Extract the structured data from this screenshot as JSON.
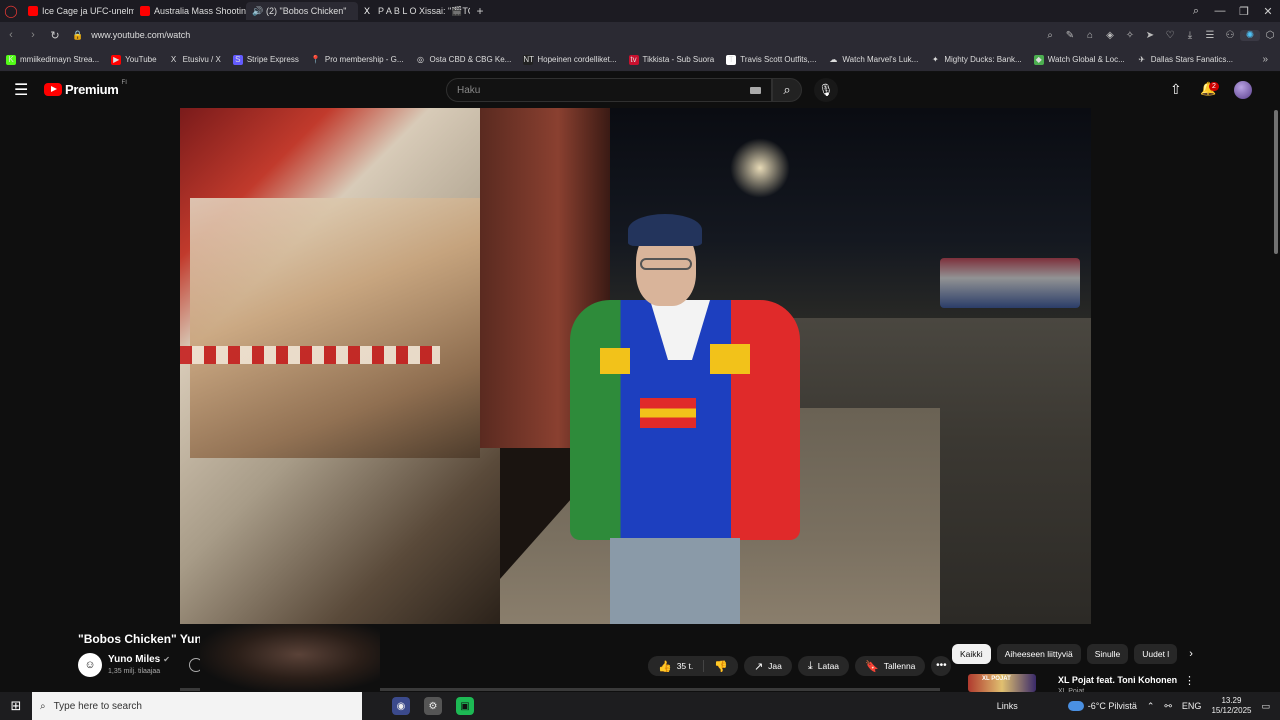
{
  "tabs": [
    {
      "label": "Ice Cage ja UFC-unelma",
      "icon": "youtube-favicon",
      "active": false
    },
    {
      "label": "Australia Mass Shooting",
      "icon": "youtube-favicon",
      "active": false
    },
    {
      "label": "(2) \"Bobos Chicken\"",
      "icon": "speaker-icon",
      "active": true
    },
    {
      "label": "P A B L O  Xissai: \"🎬TOP",
      "icon": "x-favicon",
      "active": false
    }
  ],
  "address": {
    "url": "www.youtube.com/watch"
  },
  "bookmarks": [
    {
      "label": "mmiikedimayn Strea...",
      "color": "#53fc18",
      "icon": "K"
    },
    {
      "label": "YouTube",
      "color": "#ff0000",
      "icon": "▶"
    },
    {
      "label": "Etusivu / X",
      "color": "transparent",
      "icon": "X"
    },
    {
      "label": "Stripe Express",
      "color": "#635bff",
      "icon": "S"
    },
    {
      "label": "Pro membership - G...",
      "color": "transparent",
      "icon": "📍"
    },
    {
      "label": "Osta CBD & CBG Ke...",
      "color": "transparent",
      "icon": "◎"
    },
    {
      "label": "Hopeinen cordelliket...",
      "color": "#222",
      "icon": "NT"
    },
    {
      "label": "Tikkista - Sub Suora",
      "color": "#c8102e",
      "icon": "tv"
    },
    {
      "label": "Travis Scott Outfits,...",
      "color": "#fff",
      "icon": "T"
    },
    {
      "label": "Watch Marvel's Luk...",
      "color": "transparent",
      "icon": "☁"
    },
    {
      "label": "Mighty Ducks: Bank...",
      "color": "transparent",
      "icon": "✦"
    },
    {
      "label": "Watch Global & Loc...",
      "color": "#4caf50",
      "icon": "◆"
    },
    {
      "label": "Dallas Stars Fanatics...",
      "color": "transparent",
      "icon": "✈"
    }
  ],
  "header": {
    "brand": "Premium",
    "region": "FI",
    "search_placeholder": "Haku",
    "notification_count": "2"
  },
  "video": {
    "title": "\"Bobos Chicken\" Yuno M",
    "channel_name": "Yuno Miles",
    "channel_subs": "1,35 milj. tilaajaa",
    "likes": "35 t.",
    "share_label": "Jaa",
    "download_label": "Lataa",
    "save_label": "Tallenna"
  },
  "chips": [
    {
      "label": "Kaikki",
      "active": true
    },
    {
      "label": "Aiheeseen liittyviä",
      "active": false
    },
    {
      "label": "Sinulle",
      "active": false
    },
    {
      "label": "Uudet l",
      "active": false
    }
  ],
  "recommendation": {
    "title": "XL Pojat feat. Toni Kohonen",
    "channel": "XL Pojat",
    "thumb_text": "XL POJAT"
  },
  "taskbar": {
    "search_placeholder": "Type here to search",
    "links_label": "Links",
    "weather": "-6°C  Pilvistä",
    "language": "ENG",
    "time": "13.29",
    "date": "15/12/2025"
  },
  "colors": {
    "accent": "#ff0000",
    "background": "#0f0f0f",
    "chip_active": "#f1f1f1"
  }
}
